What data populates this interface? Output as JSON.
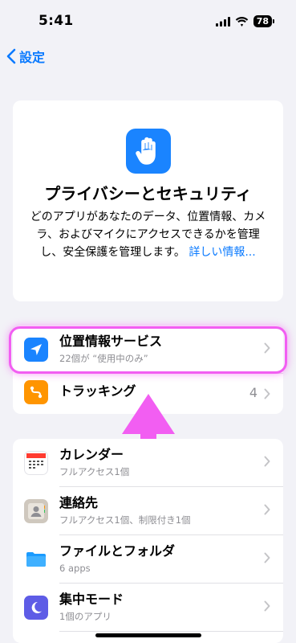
{
  "status_bar": {
    "time": "5:41",
    "battery": "78"
  },
  "nav": {
    "back_label": "設定"
  },
  "intro": {
    "title": "プライバシーとセキュリティ",
    "description": "どのアプリがあなたのデータ、位置情報、カメラ、およびマイクにアクセスできるかを管理し、安全保護を管理します。",
    "link": "詳しい情報..."
  },
  "group1": [
    {
      "title": "位置情報サービス",
      "subtitle": "22個が “使用中のみ”",
      "icon": "location-arrow-icon",
      "color": "#1a84ff"
    },
    {
      "title": "トラッキング",
      "count": "4",
      "icon": "tracking-icon",
      "color": "#ff9500"
    }
  ],
  "group2": [
    {
      "title": "カレンダー",
      "subtitle": "フルアクセス1個",
      "icon": "calendar-icon"
    },
    {
      "title": "連絡先",
      "subtitle": "フルアクセス1個、制限付き1個",
      "icon": "contacts-icon"
    },
    {
      "title": "ファイルとフォルダ",
      "subtitle": "6 apps",
      "icon": "folder-icon"
    },
    {
      "title": "集中モード",
      "subtitle": "1個のアプリ",
      "icon": "moon-icon"
    }
  ],
  "colors": {
    "accent": "#0a7aff",
    "highlight": "#f25ef2"
  }
}
